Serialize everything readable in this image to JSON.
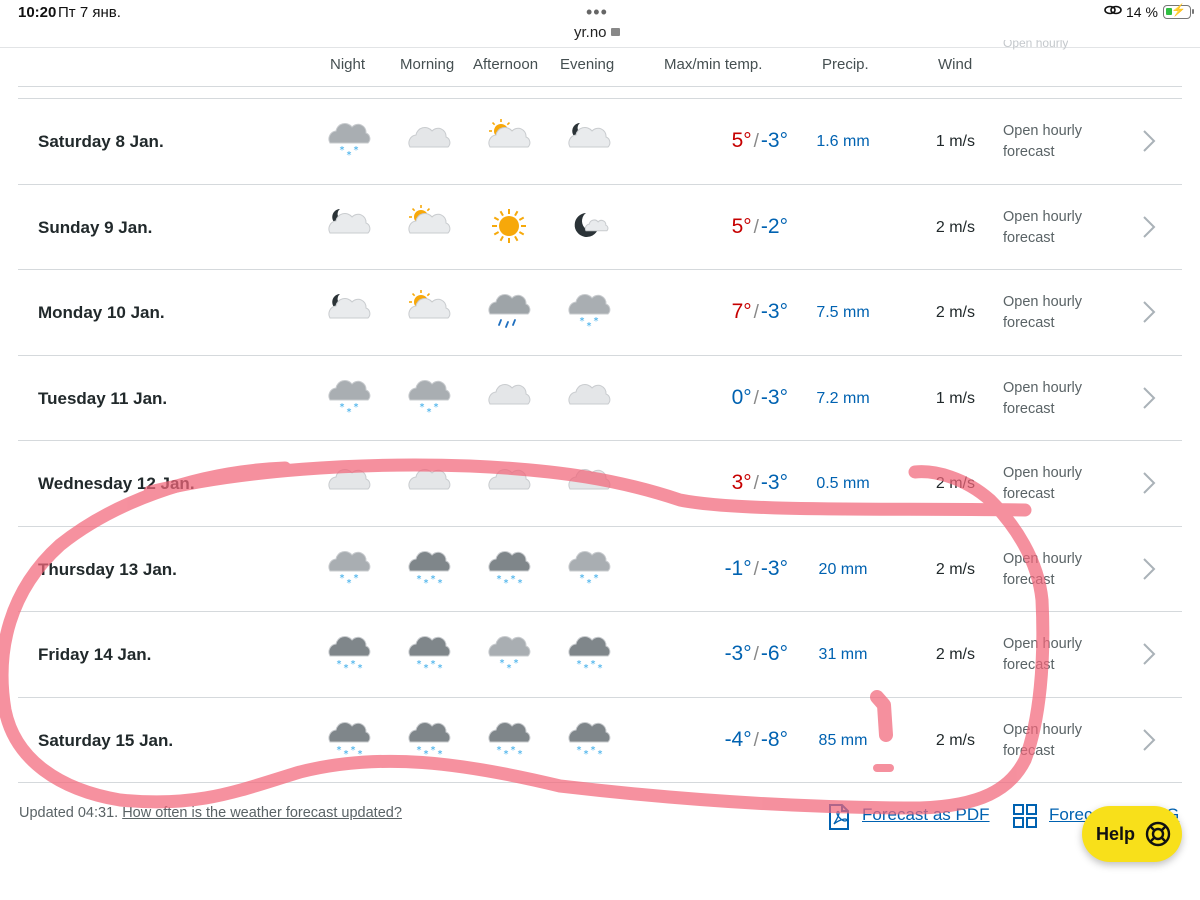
{
  "status_bar": {
    "time": "10:20",
    "date": "Пт 7 янв.",
    "url": "yr.no",
    "battery": "14 %"
  },
  "columns": {
    "night": "Night",
    "morning": "Morning",
    "afternoon": "Afternoon",
    "evening": "Evening",
    "temp": "Max/min temp.",
    "precip": "Precip.",
    "wind": "Wind"
  },
  "open_hourly_line1": "Open hourly",
  "open_hourly_line2": "forecast",
  "rows": [
    {
      "day": "Saturday 8 Jan.",
      "icons": [
        "snow-light",
        "cloudy",
        "partly-sunny",
        "partly-night"
      ],
      "max": "5°",
      "max_style": "warm",
      "min": "-3°",
      "precip": "1.6 mm",
      "wind": "1 m/s"
    },
    {
      "day": "Sunday 9 Jan.",
      "icons": [
        "partly-night",
        "partly-sunny",
        "sun",
        "clear-night"
      ],
      "max": "5°",
      "max_style": "warm",
      "min": "-2°",
      "precip": "",
      "wind": "2 m/s"
    },
    {
      "day": "Monday 10 Jan.",
      "icons": [
        "partly-night",
        "partly-sunny",
        "rain",
        "snow-light"
      ],
      "max": "7°",
      "max_style": "warm",
      "min": "-3°",
      "precip": "7.5 mm",
      "wind": "2 m/s"
    },
    {
      "day": "Tuesday 11 Jan.",
      "icons": [
        "snow-light",
        "snow-light",
        "cloudy",
        "cloudy"
      ],
      "max": "0°",
      "max_style": "cold",
      "min": "-3°",
      "precip": "7.2 mm",
      "wind": "1 m/s"
    },
    {
      "day": "Wednesday 12 Jan.",
      "icons": [
        "cloudy",
        "cloudy",
        "cloudy",
        "cloudy"
      ],
      "max": "3°",
      "max_style": "warm",
      "min": "-3°",
      "precip": "0.5 mm",
      "wind": "2 m/s"
    },
    {
      "day": "Thursday 13 Jan.",
      "icons": [
        "snow-light",
        "snow-heavy",
        "snow-heavy",
        "snow-light"
      ],
      "max": "-1°",
      "max_style": "cold",
      "min": "-3°",
      "precip": "20 mm",
      "wind": "2 m/s"
    },
    {
      "day": "Friday 14 Jan.",
      "icons": [
        "snow-heavy",
        "snow-heavy",
        "snow-light",
        "snow-heavy"
      ],
      "max": "-3°",
      "max_style": "cold",
      "min": "-6°",
      "precip": "31 mm",
      "wind": "2 m/s"
    },
    {
      "day": "Saturday 15 Jan.",
      "icons": [
        "snow-heavy",
        "snow-heavy",
        "snow-heavy",
        "snow-heavy"
      ],
      "max": "-4°",
      "max_style": "cold",
      "min": "-8°",
      "precip": "85 mm",
      "wind": "2 m/s"
    }
  ],
  "footer": {
    "updated": "Updated 04:31.",
    "how_often_link": "How often is the weather forecast updated?",
    "pdf_link": "Forecast as PDF",
    "svg_link": "Forec",
    "svg_link_tail": "G"
  },
  "help_button": "Help",
  "colors": {
    "warm": "#c60000",
    "cold": "#0062b1",
    "marker": "#f2667a",
    "help_bg": "#f8e01a"
  }
}
